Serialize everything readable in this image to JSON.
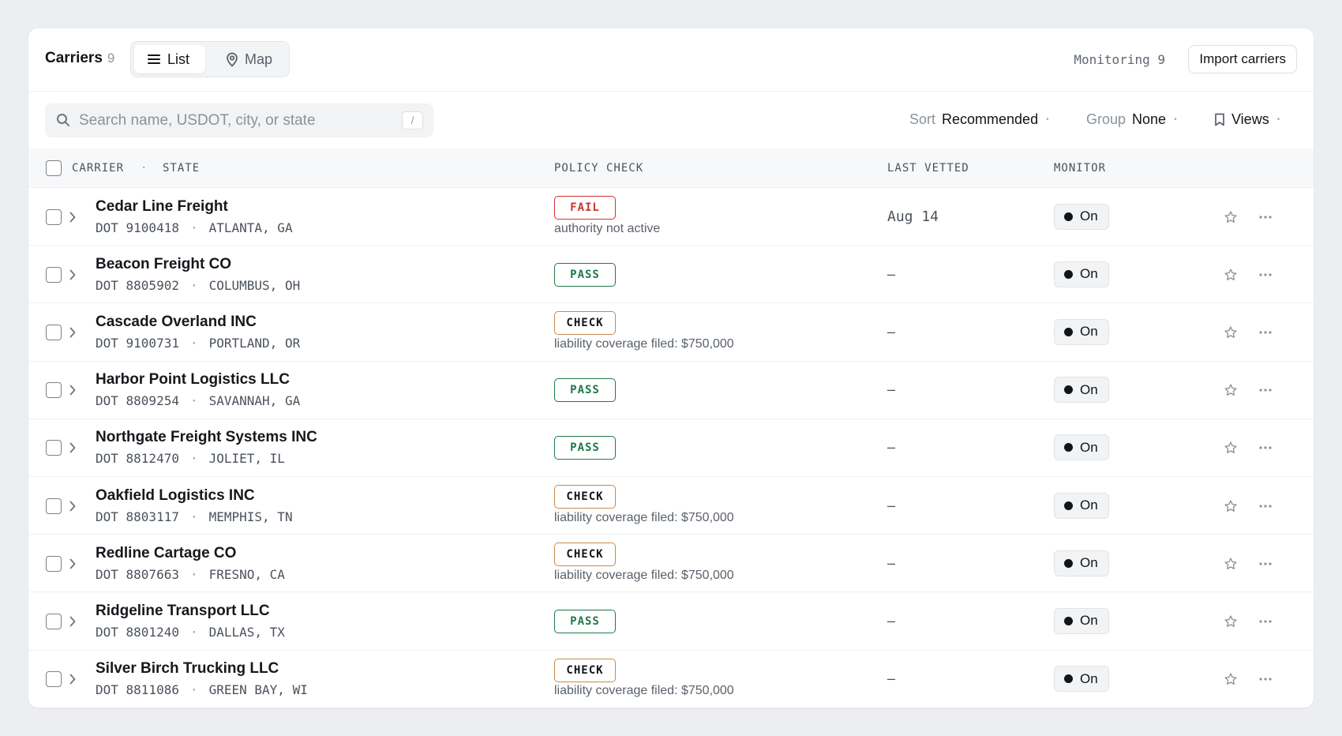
{
  "header": {
    "title": "Carriers",
    "count": "9",
    "view_tabs": [
      {
        "label": "List",
        "icon": "list-icon",
        "active": true
      },
      {
        "label": "Map",
        "icon": "map-pin-icon",
        "active": false
      }
    ],
    "monitoring_label": "Monitoring",
    "monitoring_count": "9",
    "import_label": "Import carriers"
  },
  "filters": {
    "search_placeholder": "Search name, USDOT, city, or state",
    "search_value": "",
    "search_shortcut": "/",
    "sort_label": "Sort",
    "sort_value": "Recommended",
    "group_label": "Group",
    "group_value": "None",
    "views_label": "Views"
  },
  "columns": {
    "carrier": "CARRIER",
    "state": "STATE",
    "policy": "POLICY CHECK",
    "vetted": "LAST VETTED",
    "monitor": "MONITOR"
  },
  "colors": {
    "fail": "#d0342c",
    "pass": "#1f7a4a",
    "check_border": "#c98a4b",
    "check_text": "#111418"
  },
  "rows": [
    {
      "name": "Cedar Line Freight",
      "dot": "DOT 9100418",
      "location": "ATLANTA, GA",
      "status": "FAIL",
      "note": "authority not active",
      "vetted": "Aug 14",
      "monitor": "On"
    },
    {
      "name": "Beacon Freight CO",
      "dot": "DOT 8805902",
      "location": "COLUMBUS, OH",
      "status": "PASS",
      "note": "",
      "vetted": "–",
      "monitor": "On"
    },
    {
      "name": "Cascade Overland INC",
      "dot": "DOT 9100731",
      "location": "PORTLAND, OR",
      "status": "CHECK",
      "note": "liability coverage filed: $750,000",
      "vetted": "–",
      "monitor": "On"
    },
    {
      "name": "Harbor Point Logistics LLC",
      "dot": "DOT 8809254",
      "location": "SAVANNAH, GA",
      "status": "PASS",
      "note": "",
      "vetted": "–",
      "monitor": "On"
    },
    {
      "name": "Northgate Freight Systems INC",
      "dot": "DOT 8812470",
      "location": "JOLIET, IL",
      "status": "PASS",
      "note": "",
      "vetted": "–",
      "monitor": "On"
    },
    {
      "name": "Oakfield Logistics INC",
      "dot": "DOT 8803117",
      "location": "MEMPHIS, TN",
      "status": "CHECK",
      "note": "liability coverage filed: $750,000",
      "vetted": "–",
      "monitor": "On"
    },
    {
      "name": "Redline Cartage CO",
      "dot": "DOT 8807663",
      "location": "FRESNO, CA",
      "status": "CHECK",
      "note": "liability coverage filed: $750,000",
      "vetted": "–",
      "monitor": "On"
    },
    {
      "name": "Ridgeline Transport LLC",
      "dot": "DOT 8801240",
      "location": "DALLAS, TX",
      "status": "PASS",
      "note": "",
      "vetted": "–",
      "monitor": "On"
    },
    {
      "name": "Silver Birch Trucking LLC",
      "dot": "DOT 8811086",
      "location": "GREEN BAY, WI",
      "status": "CHECK",
      "note": "liability coverage filed: $750,000",
      "vetted": "–",
      "monitor": "On"
    }
  ]
}
